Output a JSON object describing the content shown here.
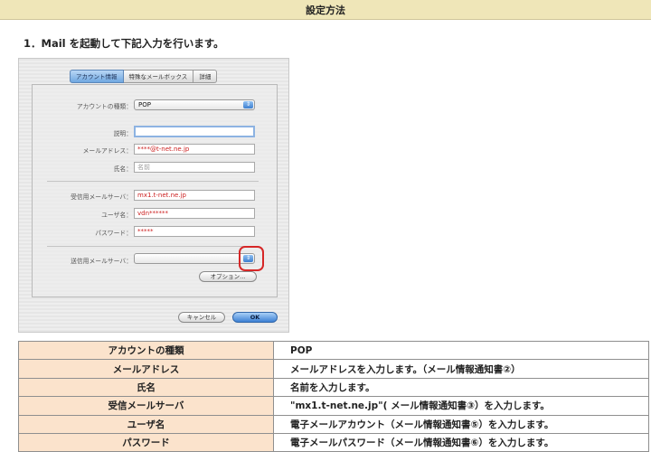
{
  "header": {
    "title": "設定方法"
  },
  "step": {
    "text": "1．Mail を起動して下記入力を行います。"
  },
  "dialog": {
    "tabs": [
      {
        "label": "アカウント情報",
        "active": true
      },
      {
        "label": "特殊なメールボックス",
        "active": false
      },
      {
        "label": "詳細",
        "active": false
      }
    ],
    "account_type": {
      "label": "アカウントの種類：",
      "value": "POP"
    },
    "description": {
      "label": "説明：",
      "value": ""
    },
    "email": {
      "label": "メールアドレス：",
      "value": "****@t-net.ne.jp"
    },
    "name": {
      "label": "氏名：",
      "value": "名前"
    },
    "incoming_server": {
      "label": "受信用メールサーバ：",
      "value": "mx1.t-net.ne.jp"
    },
    "username": {
      "label": "ユーザ名：",
      "value": "vdn******"
    },
    "password": {
      "label": "パスワード：",
      "value": "*****"
    },
    "outgoing_server": {
      "label": "送信用メールサーバ：",
      "value": ""
    },
    "options_button": "オプション...",
    "cancel_button": "キャンセル",
    "ok_button": "OK",
    "colors": {
      "input_text": "#cc1f1f",
      "highlight": "#d62727",
      "primary_button": "#3c80d4"
    }
  },
  "table": {
    "rows": [
      {
        "key": "アカウントの種類",
        "value": "POP"
      },
      {
        "key": "メールアドレス",
        "value": "メールアドレスを入力します。（メール情報通知書②）"
      },
      {
        "key": "氏名",
        "value": "名前を入力します。"
      },
      {
        "key": "受信メールサーバ",
        "value": "\"mx1.t-net.ne.jp\"( メール情報通知書③）を入力します。"
      },
      {
        "key": "ユーザ名",
        "value": "電子メールアカウント（メール情報通知書⑤）を入力します。"
      },
      {
        "key": "パスワード",
        "value": "電子メールパスワード（メール情報通知書⑥）を入力します。"
      }
    ],
    "colors": {
      "key_bg": "#fbe3cc",
      "border": "#8f8f8f"
    }
  }
}
